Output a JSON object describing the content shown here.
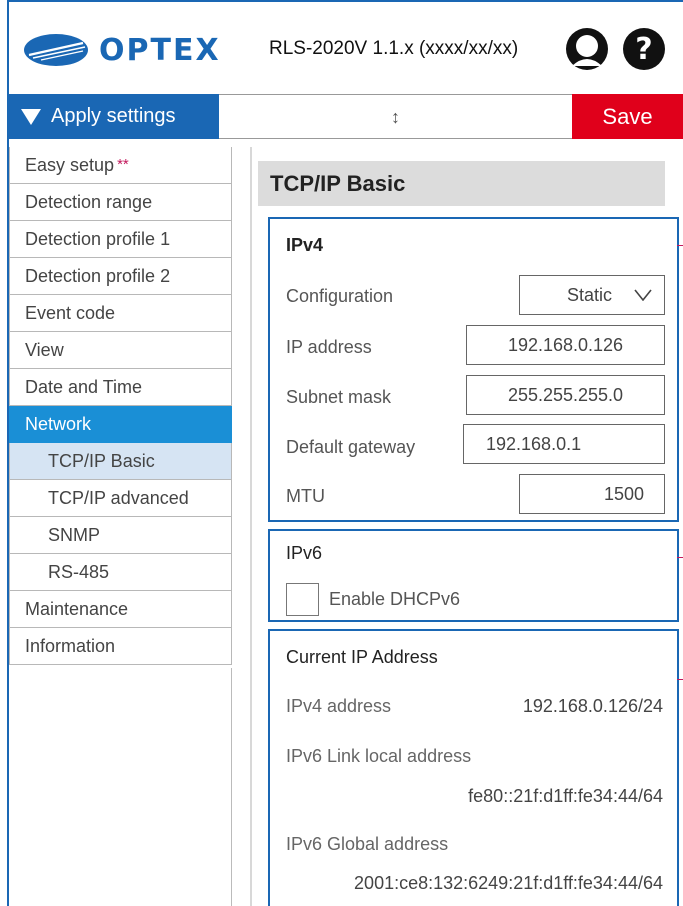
{
  "brand": {
    "logo_text": "OPTEX",
    "accent": "#1a67b4",
    "save_color": "#e0001b",
    "active_nav_color": "#1a8fd6"
  },
  "header": {
    "product": "RLS-2020V 1.1.x (xxxx/xx/xx)",
    "user_icon": "user-icon",
    "help_icon": "help-icon"
  },
  "toolbar": {
    "apply_label": "Apply settings",
    "mid_symbol": "↕",
    "save_label": "Save"
  },
  "sidebar": {
    "items": [
      {
        "label": "Easy setup",
        "mark": "**"
      },
      {
        "label": "Detection range"
      },
      {
        "label": "Detection profile 1"
      },
      {
        "label": "Detection profile 2"
      },
      {
        "label": "Event code"
      },
      {
        "label": "View"
      },
      {
        "label": "Date and Time"
      },
      {
        "label": "Network"
      },
      {
        "label": "TCP/IP Basic"
      },
      {
        "label": "TCP/IP advanced"
      },
      {
        "label": "SNMP"
      },
      {
        "label": "RS-485"
      },
      {
        "label": "Maintenance"
      },
      {
        "label": "Information"
      }
    ]
  },
  "main": {
    "title": "TCP/IP Basic",
    "ipv4": {
      "title": "IPv4",
      "configuration_label": "Configuration",
      "configuration_value": "Static",
      "ip_label": "IP address",
      "ip_value": "192.168.0.126",
      "subnet_label": "Subnet mask",
      "subnet_value": "255.255.255.0",
      "gateway_label": "Default gateway",
      "gateway_value": "192.168.0.1",
      "mtu_label": "MTU",
      "mtu_value": "1500"
    },
    "ipv6": {
      "title": "IPv6",
      "dhcp_label": "Enable DHCPv6",
      "dhcp_checked": false
    },
    "current": {
      "title": "Current IP Address",
      "ipv4_label": "IPv4 address",
      "ipv4_value": "192.168.0.126/24",
      "link_local_label": "IPv6 Link local address",
      "link_local_value": "fe80::21f:d1ff:fe34:44/64",
      "global_label": "IPv6 Global address",
      "global_value": "2001:ce8:132:6249:21f:d1ff:fe34:44/64"
    }
  }
}
